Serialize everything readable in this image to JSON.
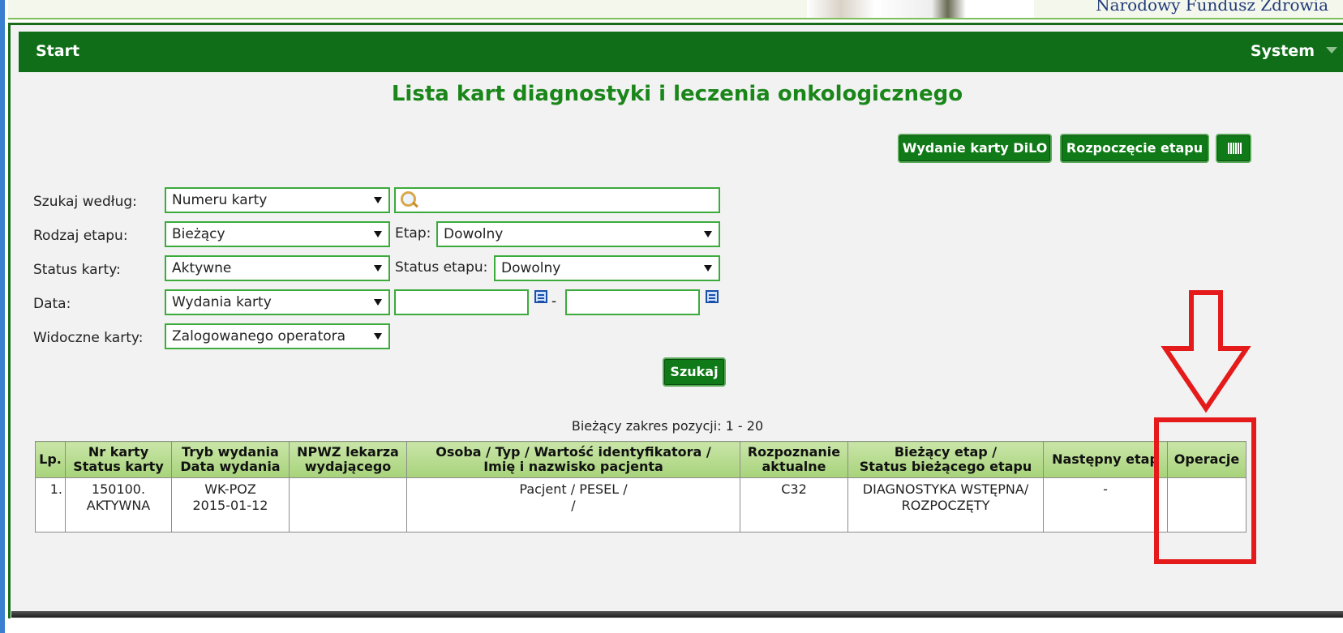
{
  "banner": {
    "org_text": "Narodowy Fundusz Zdrowia"
  },
  "nav": {
    "start_label": "Start",
    "system_label": "System"
  },
  "page_title": "Lista kart diagnostyki i leczenia onkologicznego",
  "toolbar": {
    "issue_card_label": "Wydanie karty DiLO",
    "start_stage_label": "Rozpoczęcie etapu",
    "barcode_icon": "barcode-icon"
  },
  "filters": {
    "search_by_label": "Szukaj według:",
    "search_by_value": "Numeru karty",
    "search_value": "",
    "stage_kind_label": "Rodzaj etapu:",
    "stage_kind_value": "Bieżący",
    "stage_label": "Etap:",
    "stage_value": "Dowolny",
    "card_status_label": "Status karty:",
    "card_status_value": "Aktywne",
    "stage_status_label": "Status etapu:",
    "stage_status_value": "Dowolny",
    "date_label": "Data:",
    "date_value": "Wydania karty",
    "date_from": "",
    "date_to": "",
    "date_separator": "-",
    "visible_cards_label": "Widoczne karty:",
    "visible_cards_value": "Zalogowanego operatora",
    "search_button_label": "Szukaj"
  },
  "results_range": "Bieżący zakres pozycji: 1 - 20",
  "table": {
    "headers": [
      [
        "Lp."
      ],
      [
        "Nr karty",
        "Status karty"
      ],
      [
        "Tryb wydania",
        "Data wydania"
      ],
      [
        "NPWZ lekarza",
        "wydającego"
      ],
      [
        "Osoba / Typ / Wartość identyfikatora /",
        "Imię i nazwisko pacjenta"
      ],
      [
        "Rozpoznanie",
        "aktualne"
      ],
      [
        "Bieżący etap /",
        "Status bieżącego etapu"
      ],
      [
        "Następny etap"
      ],
      [
        "Operacje"
      ]
    ],
    "rows": [
      {
        "lp": "1.",
        "card_no": "150100.",
        "card_status": "AKTYWNA",
        "mode": "WK-POZ",
        "issue_date": "2015-01-12",
        "npwz": "",
        "person_line1": "Pacjent / PESEL /",
        "person_line2": "/",
        "diagnosis": "C32",
        "stage": "DIAGNOSTYKA WSTĘPNA/",
        "stage_status": "ROZPOCZĘTY",
        "next_stage": "-",
        "operations": ""
      }
    ]
  },
  "colors": {
    "nav_green": "#0f6e17",
    "title_green": "#1a861a",
    "annotation_red": "#e51b1b"
  }
}
